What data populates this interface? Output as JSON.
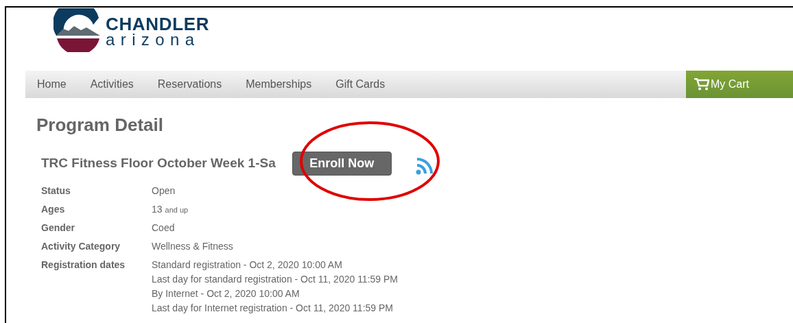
{
  "logo": {
    "name": "CHANDLER",
    "subtitle": "arizona"
  },
  "nav": {
    "items": [
      {
        "label": "Home"
      },
      {
        "label": "Activities"
      },
      {
        "label": "Reservations"
      },
      {
        "label": "Memberships"
      },
      {
        "label": "Gift Cards"
      }
    ],
    "cart": "My Cart"
  },
  "page_title": "Program Detail",
  "program": {
    "title": "TRC Fitness Floor October Week 1-Sa",
    "enroll_button": "Enroll Now",
    "highlighted": true
  },
  "details": [
    {
      "label": "Status",
      "lines": [
        "Open"
      ]
    },
    {
      "label": "Ages",
      "lines": [
        "13"
      ],
      "suffix": "and up"
    },
    {
      "label": "Gender",
      "lines": [
        "Coed"
      ]
    },
    {
      "label": "Activity Category",
      "lines": [
        "Wellness & Fitness"
      ]
    },
    {
      "label": "Registration dates",
      "lines": [
        "Standard registration - Oct 2, 2020 10:00 AM",
        "Last day for standard registration - Oct 11, 2020 11:59 PM",
        "By Internet - Oct 2, 2020 10:00 AM",
        "Last day for Internet registration - Oct 11, 2020 11:59 PM"
      ]
    }
  ]
}
